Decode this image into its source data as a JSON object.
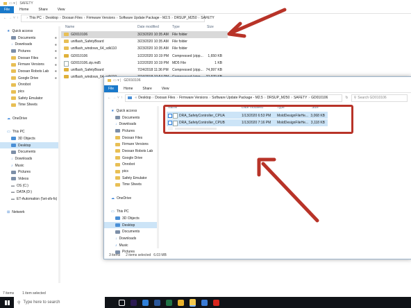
{
  "back_window": {
    "title": "SAFETY",
    "ribbon_tabs": [
      "File",
      "Home",
      "Share",
      "View"
    ],
    "breadcrumb": [
      "This PC",
      "Desktop",
      "Doosan Files",
      "Firmware Versions",
      "Software Update Package - M2.5",
      "DRSUP_M250",
      "SAFETY"
    ],
    "columns": {
      "name": "Name",
      "date": "Date modified",
      "type": "Type",
      "size": "Size"
    },
    "files": [
      {
        "name": "GD010106",
        "date": "3/23/2020 10:35 AM",
        "type": "File folder",
        "size": "",
        "icon": "folder"
      },
      {
        "name": "uniflash_SafetyBoard",
        "date": "3/23/2020 10:35 AM",
        "type": "File folder",
        "size": "",
        "icon": "folder"
      },
      {
        "name": "uniflash_windows_64_sdk110",
        "date": "3/23/2020 10:35 AM",
        "type": "File folder",
        "size": "",
        "icon": "folder"
      },
      {
        "name": "GD010106",
        "date": "1/22/2020 10:19 PM",
        "type": "Compressed (zipp...",
        "size": "1,650 KB",
        "icon": "zip"
      },
      {
        "name": "GD010106.zip.md5",
        "date": "1/22/2020 10:19 PM",
        "type": "MD5 File",
        "size": "1 KB",
        "icon": "file"
      },
      {
        "name": "uniflash_SafetyBoard",
        "date": "7/24/2018 11:36 PM",
        "type": "Compressed (zipp...",
        "size": "74,997 KB",
        "icon": "zip"
      },
      {
        "name": "uniflash_windows_64_sdk110",
        "date": "7/24/2018 10:54 PM",
        "type": "Compressed (zipp...",
        "size": "22,970 KB",
        "icon": "zip"
      }
    ],
    "nav": [
      {
        "label": "Quick access",
        "icon": "star",
        "level": 0,
        "pinned": false
      },
      {
        "label": "Documents",
        "icon": "folder-dark",
        "level": 1,
        "pinned": true
      },
      {
        "label": "Downloads",
        "icon": "download",
        "level": 1,
        "pinned": true
      },
      {
        "label": "Pictures",
        "icon": "folder-dark",
        "level": 1,
        "pinned": true
      },
      {
        "label": "Doosan Files",
        "icon": "folder",
        "level": 1,
        "pinned": true
      },
      {
        "label": "Firmare Versions",
        "icon": "folder",
        "level": 1,
        "pinned": true
      },
      {
        "label": "Doosan Robots Lab",
        "icon": "folder",
        "level": 1,
        "pinned": true
      },
      {
        "label": "Google Drive",
        "icon": "folder",
        "level": 1,
        "pinned": true
      },
      {
        "label": "Onrobot",
        "icon": "folder",
        "level": 1,
        "pinned": false
      },
      {
        "label": "pics",
        "icon": "folder",
        "level": 1,
        "pinned": false
      },
      {
        "label": "Safety Emulator",
        "icon": "folder",
        "level": 1,
        "pinned": false
      },
      {
        "label": "Time Sheets",
        "icon": "folder",
        "level": 1,
        "pinned": false
      },
      {
        "label": "",
        "icon": "",
        "level": 0,
        "pinned": false
      },
      {
        "label": "OneDrive",
        "icon": "cloud",
        "level": 0,
        "pinned": false
      },
      {
        "label": "",
        "icon": "",
        "level": 0,
        "pinned": false
      },
      {
        "label": "This PC",
        "icon": "pc",
        "level": 0,
        "pinned": false
      },
      {
        "label": "3D Objects",
        "icon": "folder-blue",
        "level": 1,
        "pinned": false
      },
      {
        "label": "Desktop",
        "icon": "folder-blue",
        "level": 1,
        "pinned": false,
        "selected": true
      },
      {
        "label": "Documents",
        "icon": "folder-dark",
        "level": 1,
        "pinned": false
      },
      {
        "label": "Downloads",
        "icon": "download",
        "level": 1,
        "pinned": false
      },
      {
        "label": "Music",
        "icon": "music",
        "level": 1,
        "pinned": false
      },
      {
        "label": "Pictures",
        "icon": "folder-dark",
        "level": 1,
        "pinned": false
      },
      {
        "label": "Videos",
        "icon": "folder-dark",
        "level": 1,
        "pinned": false
      },
      {
        "label": "OS (C:)",
        "icon": "drive",
        "level": 1,
        "pinned": false
      },
      {
        "label": "DATA (D:)",
        "icon": "drive",
        "level": 1,
        "pinned": false
      },
      {
        "label": "ET-Automation (\\\\et-sfs-fs)",
        "icon": "drive",
        "level": 1,
        "pinned": false
      },
      {
        "label": "",
        "icon": "",
        "level": 0,
        "pinned": false
      },
      {
        "label": "Network",
        "icon": "network",
        "level": 0,
        "pinned": false
      }
    ],
    "status": {
      "count": "7 items",
      "selected": "1 item selected"
    }
  },
  "front_window": {
    "title": "GD010106",
    "ribbon_tabs": [
      "File",
      "Home",
      "Share",
      "View"
    ],
    "breadcrumb": [
      "Desktop",
      "Doosan Files",
      "Firmware Versions",
      "Software Update Package - M2.5",
      "DRSUP_M250",
      "SAFETY",
      "GD010106"
    ],
    "search_placeholder": "Search GD010106",
    "columns": {
      "name": "Name",
      "date": "Date modified",
      "type": "Type",
      "size": "Size"
    },
    "files": [
      {
        "name": "DRA_SafetyController_CPUA",
        "date": "1/13/2020 6:53 PM",
        "type": "MoldDesignFileHe...",
        "size": "3,068 KB"
      },
      {
        "name": "DRA_SafetyController_CPUB",
        "date": "1/13/2020 7:16 PM",
        "type": "MoldDesignFileHe...",
        "size": "3,118 KB"
      }
    ],
    "nav": [
      {
        "label": "Quick access",
        "level": 0,
        "icon": "star"
      },
      {
        "label": "Documents",
        "level": 1,
        "icon": "folder-dark"
      },
      {
        "label": "Downloads",
        "level": 1,
        "icon": "download"
      },
      {
        "label": "Pictures",
        "level": 1,
        "icon": "folder-dark"
      },
      {
        "label": "Doosan Files",
        "level": 1,
        "icon": "folder"
      },
      {
        "label": "Firmare Versions",
        "level": 1,
        "icon": "folder"
      },
      {
        "label": "Doosan Robots Lab",
        "level": 1,
        "icon": "folder"
      },
      {
        "label": "Google Drive",
        "level": 1,
        "icon": "folder"
      },
      {
        "label": "Onrobot",
        "level": 1,
        "icon": "folder"
      },
      {
        "label": "pics",
        "level": 1,
        "icon": "folder"
      },
      {
        "label": "Safety Emulator",
        "level": 1,
        "icon": "folder"
      },
      {
        "label": "Time Sheets",
        "level": 1,
        "icon": "folder"
      },
      {
        "label": "",
        "level": 0,
        "icon": ""
      },
      {
        "label": "OneDrive",
        "level": 0,
        "icon": "cloud"
      },
      {
        "label": "",
        "level": 0,
        "icon": ""
      },
      {
        "label": "This PC",
        "level": 0,
        "icon": "pc"
      },
      {
        "label": "3D Objects",
        "level": 1,
        "icon": "folder-blue"
      },
      {
        "label": "Desktop",
        "level": 1,
        "icon": "folder-blue",
        "selected": true
      },
      {
        "label": "Documents",
        "level": 1,
        "icon": "folder-dark"
      },
      {
        "label": "Downloads",
        "level": 1,
        "icon": "download"
      },
      {
        "label": "Music",
        "level": 1,
        "icon": "music"
      },
      {
        "label": "Pictures",
        "level": 1,
        "icon": "folder-dark"
      }
    ],
    "status": {
      "count": "3 items",
      "selected": "2 items selected",
      "size": "6.03 MB"
    }
  },
  "taskbar": {
    "search_placeholder": "Type here to search",
    "apps": [
      {
        "name": "task-view-icon",
        "color": "#ffffff"
      },
      {
        "name": "premiere-icon",
        "color": "#2b1a52"
      },
      {
        "name": "edge-icon",
        "color": "#2f7fd8"
      },
      {
        "name": "word-icon",
        "color": "#2b579a"
      },
      {
        "name": "excel-icon",
        "color": "#217346"
      },
      {
        "name": "chrome-icon",
        "color": "#e9b22c"
      },
      {
        "name": "explorer-icon",
        "color": "#f3c84e"
      },
      {
        "name": "mail-icon",
        "color": "#3a7bd5"
      },
      {
        "name": "acrobat-icon",
        "color": "#d7261e"
      }
    ]
  },
  "colors": {
    "accent": "#0063b1",
    "annotation": "#b83328",
    "selection": "#cce4f7"
  }
}
